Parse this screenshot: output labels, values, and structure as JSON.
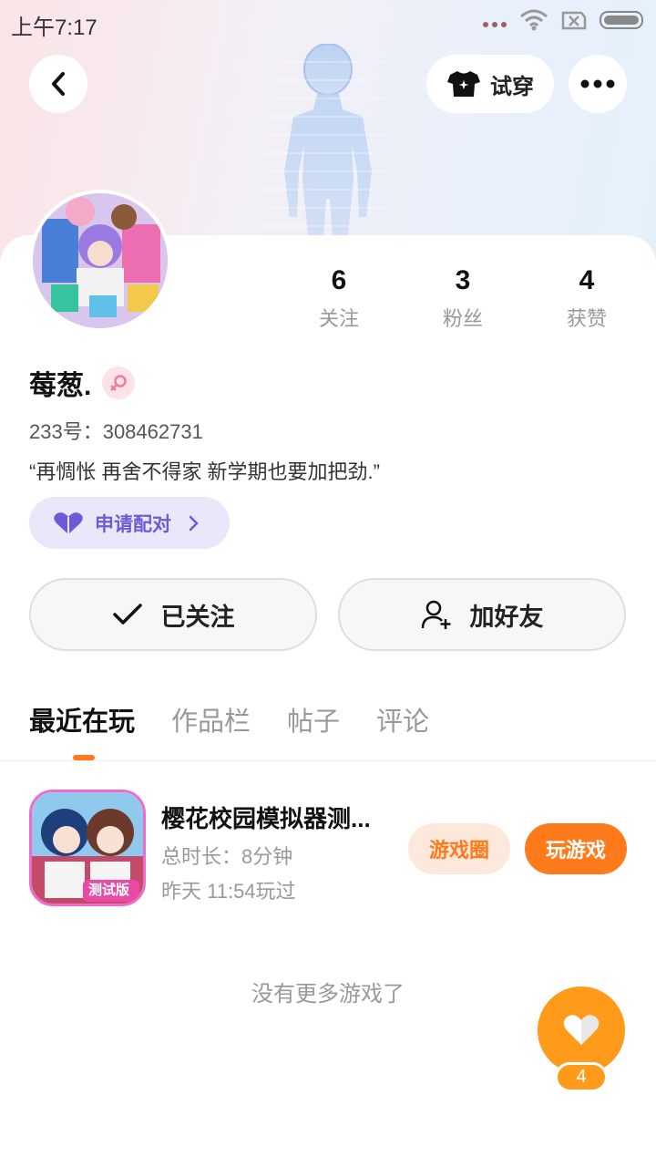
{
  "status_bar": {
    "time": "上午7:17",
    "icons": [
      "signal-dots-icon",
      "wifi-icon",
      "no-sim-icon",
      "battery-icon"
    ]
  },
  "header": {
    "back_icon": "chevron-left-icon",
    "try_on_label": "试穿",
    "try_on_icon": "tshirt-icon",
    "more_icon": "more-dots-icon"
  },
  "profile": {
    "stats": [
      {
        "value": "6",
        "label": "关注"
      },
      {
        "value": "3",
        "label": "粉丝"
      },
      {
        "value": "4",
        "label": "获赞"
      }
    ],
    "nickname": "莓葱.",
    "gender_icon": "female-icon",
    "uid": "233号：308462731",
    "bio": "“再惆怅 再舍不得家 新学期也要加把劲.”",
    "pair_label": "申请配对"
  },
  "actions": {
    "follow_label": "已关注",
    "add_friend_label": "加好友"
  },
  "tabs": [
    "最近在玩",
    "作品栏",
    "帖子",
    "评论"
  ],
  "recent_game": {
    "title": "樱花校园模拟器测...",
    "duration": "总时长：8分钟",
    "last_played": "昨天 11:54玩过",
    "icon_badge": "测试版",
    "circle_label": "游戏圈",
    "play_label": "玩游戏"
  },
  "no_more_text": "没有更多游戏了",
  "like": {
    "count": "4",
    "icon": "heart-icon"
  },
  "colors": {
    "accent": "#ff7a1a",
    "pair_purple": "#6c5bd4",
    "like_orange": "#ff9a1a"
  }
}
